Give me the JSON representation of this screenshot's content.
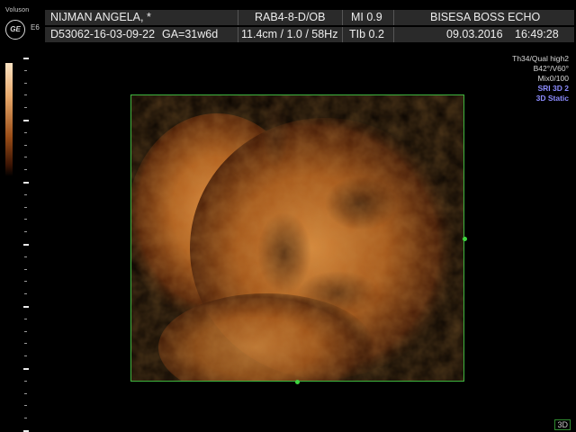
{
  "device": {
    "brand": "Voluson",
    "logo": "GE",
    "probe_code": "E6"
  },
  "header": {
    "patient_name": "NIJMAN  ANGELA,  *",
    "patient_id": "D53062-16-03-09-22",
    "gestational_age": "GA=31w6d",
    "probe": "RAB4-8-D/OB",
    "mi": "MI  0.9",
    "institution": "BISESA BOSS ECHO",
    "scan_params": "11.4cm / 1.0 / 58Hz",
    "tib": "TIb  0.2",
    "date": "09.03.2016",
    "time": "16:49:28"
  },
  "params_panel": {
    "lines": [
      {
        "text": "Th34/Qual high2",
        "color": "#d8d8d8"
      },
      {
        "text": "B42°/V60°",
        "color": "#d8d8d8"
      },
      {
        "text": "Mix0/100",
        "color": "#d8d8d8"
      },
      {
        "text": "SRI 3D 2",
        "color": "#8c8cff"
      },
      {
        "text": "3D Static",
        "color": "#8c8cff"
      }
    ]
  },
  "footer": {
    "mode_badge": "3D"
  },
  "colors": {
    "roi_border": "#3fb53f",
    "render_tint": "#c8732b",
    "highlight_text": "#8c8cff"
  }
}
